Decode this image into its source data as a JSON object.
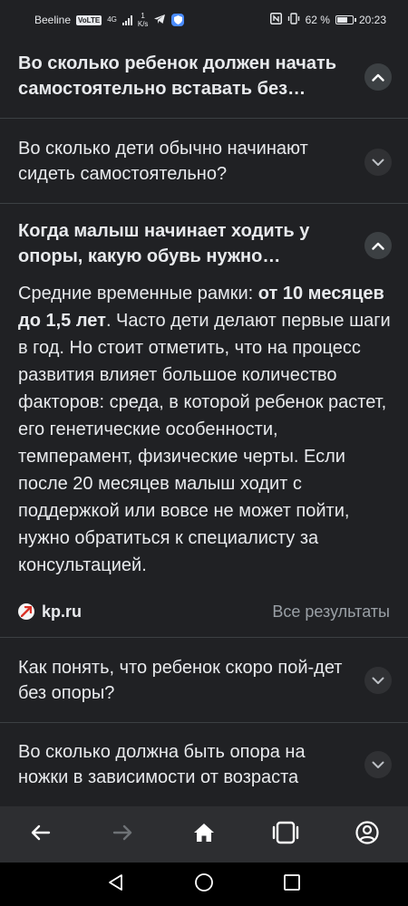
{
  "status": {
    "carrier": "Beeline",
    "volte": "VoLTE",
    "network": "4G",
    "speed_value": "1",
    "speed_unit": "K/s",
    "battery": "62 %",
    "time": "20:23"
  },
  "faq": {
    "item1": {
      "question": "Во сколько ребенок должен начать самостоятельно вставать без…",
      "state": "expanded-partial"
    },
    "item2": {
      "question": "Во сколько дети обычно начинают сидеть самостоятельно?",
      "state": "collapsed"
    },
    "item3": {
      "question": "Когда малыш начинает ходить у опоры, какую обувь нужно…",
      "state": "expanded",
      "answer_part1": "Средние временные рамки: ",
      "answer_bold": "от 10 месяцев до 1,5 лет",
      "answer_part2": ". Часто дети делают первые шаги в год. Но стоит отметить, что на процесс развития влияет большое количество факторов: среда, в которой ребенок растет, его генетические особенности, темперамент, физические черты. Если после 20 месяцев малыш ходит с поддержкой или вовсе не может пойти, нужно обратиться к специалисту за консультацией.",
      "source": "kp.ru",
      "all_results": "Все результаты"
    },
    "item4": {
      "question": "Как понять, что ребенок скоро пой-дет без опоры?",
      "state": "collapsed"
    },
    "item5": {
      "question": "Во сколько должна быть опора на ножки в зависимости от возраста",
      "state": "collapsed"
    }
  },
  "icons": {
    "back": "arrow-left-icon",
    "forward": "arrow-right-icon",
    "home": "home-icon",
    "tabs": "tabs-icon",
    "profile": "profile-icon"
  },
  "colors": {
    "background": "#202124",
    "text": "#e8eaed",
    "muted": "#9aa0a6",
    "divider": "#3c4043",
    "nav_bar": "#2d2e31"
  }
}
